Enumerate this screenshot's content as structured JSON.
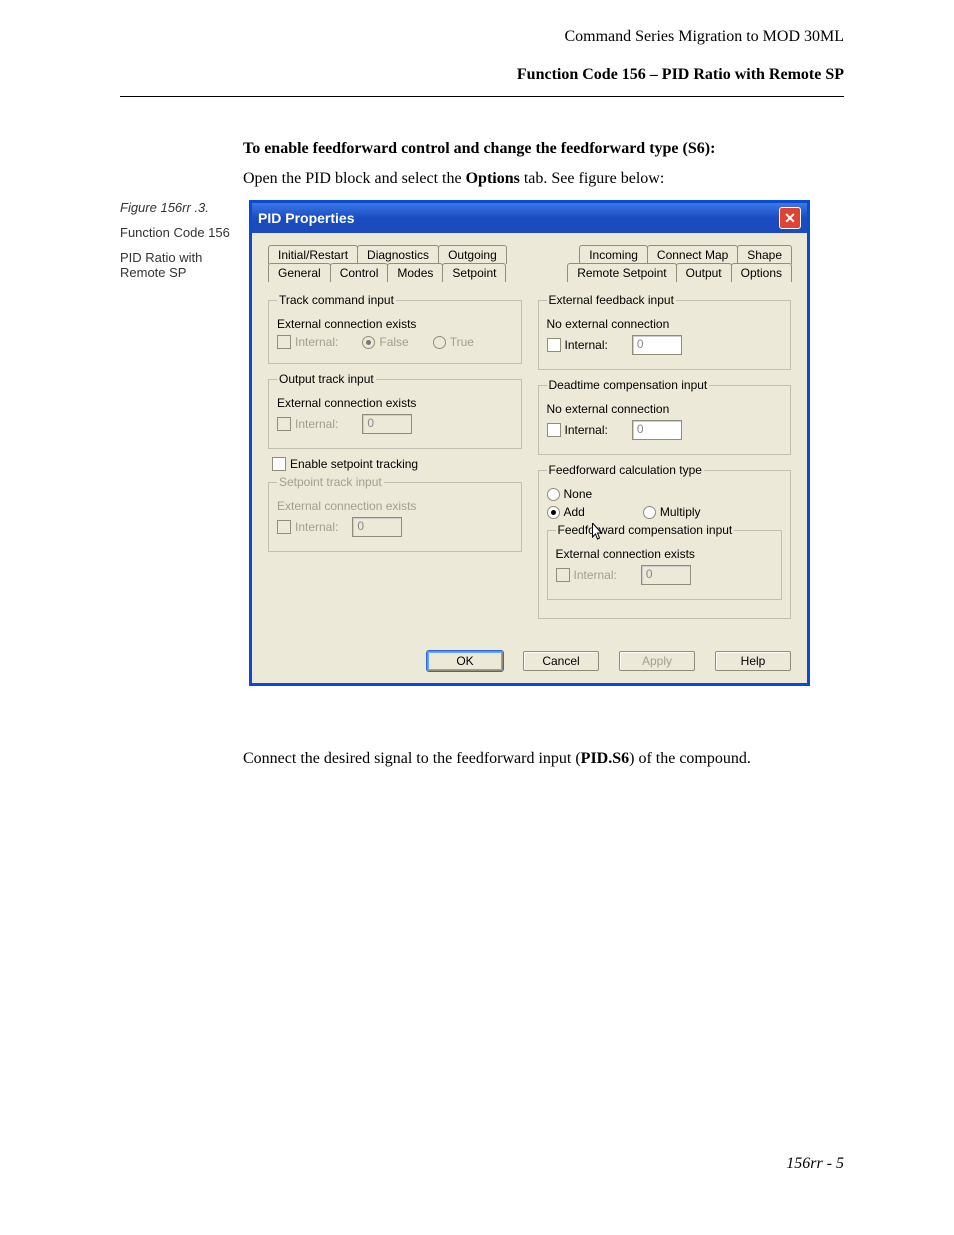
{
  "header": {
    "line1": "Command Series Migration to MOD 30ML",
    "line2": "Function Code 156 – PID Ratio with Remote SP"
  },
  "intro": {
    "bold": "To enable feedforward control and change the feedforward type (S6):",
    "plain_pre": "Open the PID block and select the ",
    "plain_bold": "Options",
    "plain_post": " tab. See figure below:"
  },
  "sidebar": {
    "figure": "Figure 156rr .3.",
    "line1": "Function Code 156",
    "line2": "PID Ratio with Remote SP"
  },
  "dialog": {
    "title": "PID Properties",
    "tabs_row1": [
      "Initial/Restart",
      "Diagnostics",
      "Outgoing"
    ],
    "tabs_row1b": [
      "Incoming",
      "Connect Map",
      "Shape"
    ],
    "tabs_row2": [
      "General",
      "Control",
      "Modes",
      "Setpoint"
    ],
    "tabs_row2b": [
      "Remote Setpoint",
      "Output",
      "Options"
    ],
    "left": {
      "g1": {
        "legend": "Track command input",
        "status": "External connection exists",
        "internal": "Internal:",
        "false": "False",
        "true": "True"
      },
      "g2": {
        "legend": "Output track input",
        "status": "External connection exists",
        "internal": "Internal:",
        "value": "0"
      },
      "enable_chk": "Enable setpoint tracking",
      "g3": {
        "legend": "Setpoint track input",
        "status": "External connection exists",
        "internal": "Internal:",
        "value": "0"
      }
    },
    "right": {
      "g1": {
        "legend": "External feedback input",
        "status": "No external connection",
        "internal": "Internal:",
        "value": "0"
      },
      "g2": {
        "legend": "Deadtime compensation input",
        "status": "No external connection",
        "internal": "Internal:",
        "value": "0"
      },
      "g3": {
        "legend": "Feedforward calculation type",
        "none": "None",
        "add": "Add",
        "multiply": "Multiply"
      },
      "g4": {
        "legend": "Feedforward compensation input",
        "status": "External connection exists",
        "internal": "Internal:",
        "value": "0"
      }
    },
    "buttons": {
      "ok": "OK",
      "cancel": "Cancel",
      "apply": "Apply",
      "help": "Help"
    }
  },
  "aftertext": {
    "pre": "Connect the desired signal to the feedforward input (",
    "bold": "PID.S6",
    "post": ") of the compound."
  },
  "footer": "156rr - 5"
}
